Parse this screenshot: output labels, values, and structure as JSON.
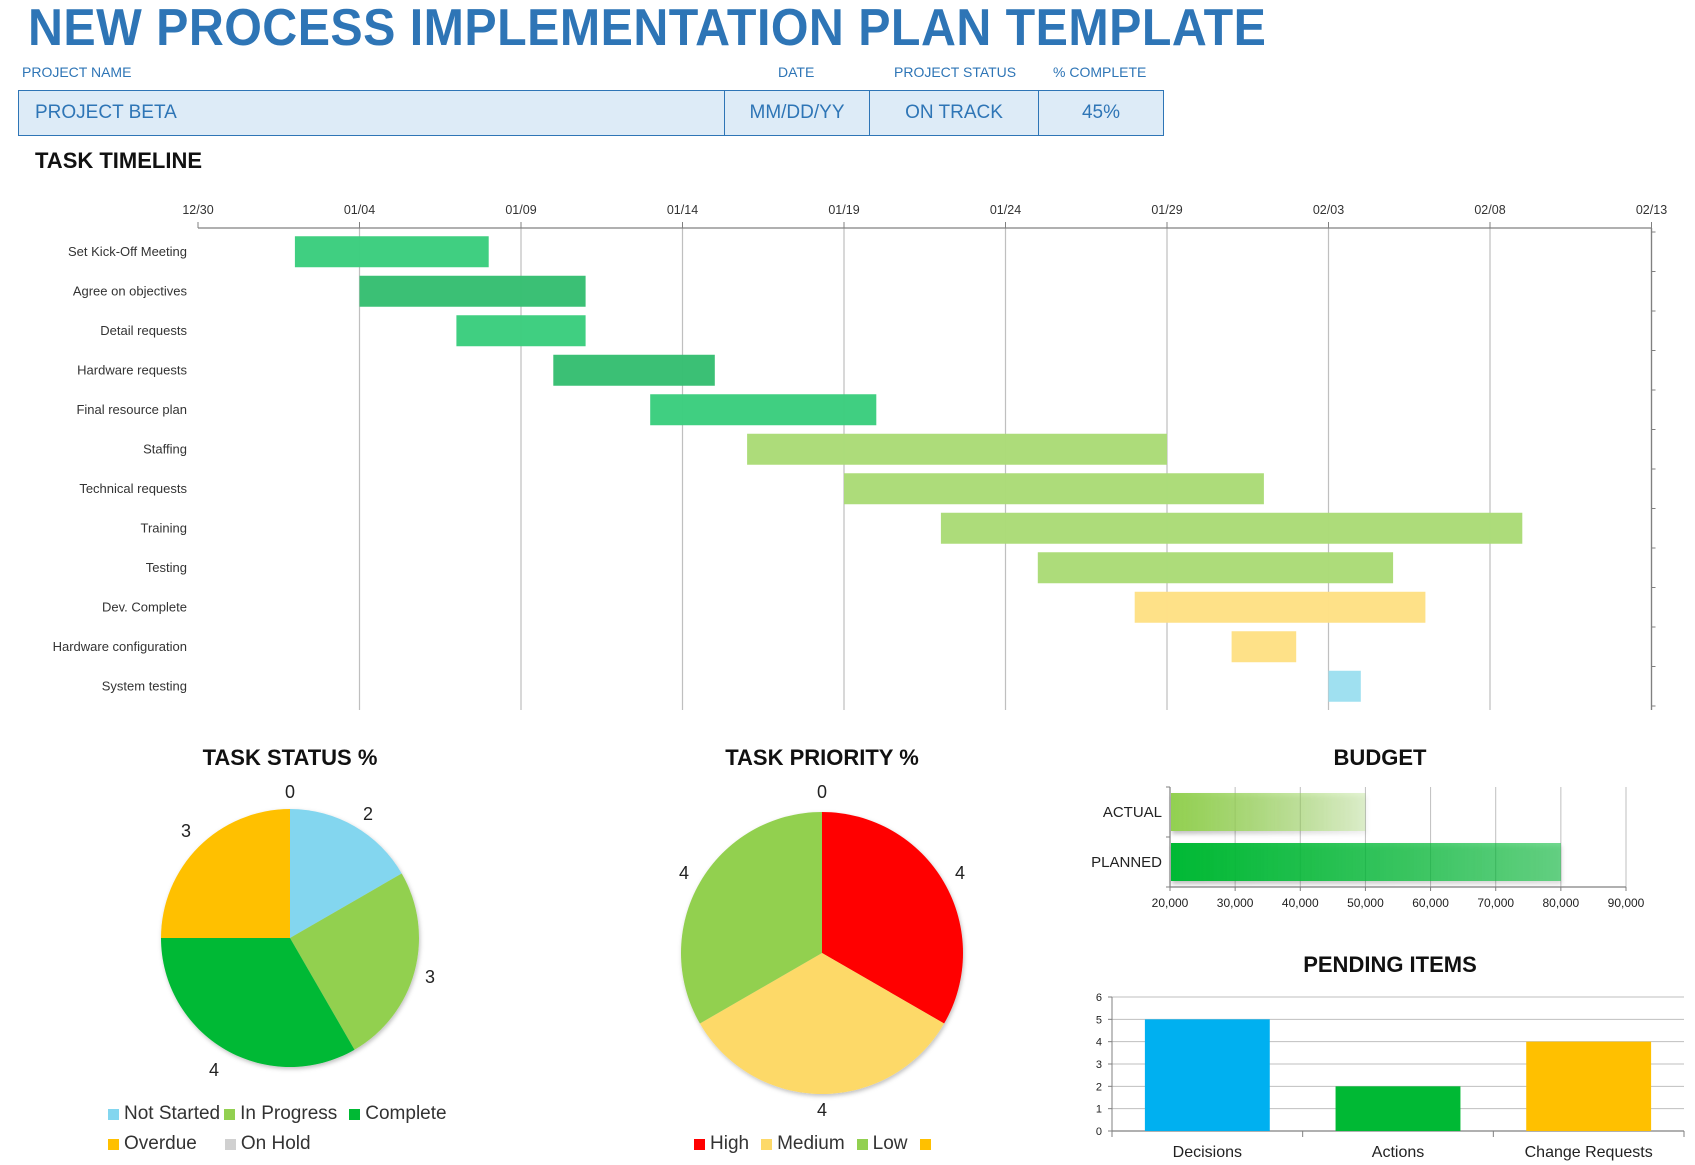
{
  "header": {
    "title": "NEW PROCESS IMPLEMENTATION PLAN TEMPLATE",
    "labels": {
      "project_name": "PROJECT NAME",
      "date": "DATE",
      "project_status": "PROJECT STATUS",
      "percent_complete": "% COMPLETE"
    },
    "values": {
      "project_name": "PROJECT BETA",
      "date": "MM/DD/YY",
      "project_status": "ON TRACK",
      "percent_complete": "45%"
    }
  },
  "colors": {
    "brand_blue": "#2E75B6",
    "info_fill": "#DDEBF7"
  },
  "chart_data": [
    {
      "id": "task-timeline",
      "type": "bar",
      "orientation": "horizontal-gantt",
      "title": "TASK TIMELINE",
      "x_tick_labels": [
        "12/30",
        "01/04",
        "01/09",
        "01/14",
        "01/19",
        "01/24",
        "01/29",
        "02/03",
        "02/08",
        "02/13"
      ],
      "x_range_days": [
        0,
        45
      ],
      "x_origin_label": "12/30",
      "grid": true,
      "tasks": [
        {
          "name": "Set Kick-Off Meeting",
          "start_day": 3,
          "duration_days": 6,
          "start": "01/02",
          "end": "01/08",
          "color": "#3CCE7E"
        },
        {
          "name": "Agree on objectives",
          "start_day": 5,
          "duration_days": 7,
          "start": "01/04",
          "end": "01/11",
          "color": "#37BF72"
        },
        {
          "name": "Detail requests",
          "start_day": 8,
          "duration_days": 4,
          "start": "01/07",
          "end": "01/11",
          "color": "#3CCE7E"
        },
        {
          "name": "Hardware requests",
          "start_day": 11,
          "duration_days": 5,
          "start": "01/10",
          "end": "01/15",
          "color": "#37BF72"
        },
        {
          "name": "Final resource plan",
          "start_day": 14,
          "duration_days": 7,
          "start": "01/13",
          "end": "01/20",
          "color": "#3CCE7E"
        },
        {
          "name": "Staffing",
          "start_day": 17,
          "duration_days": 13,
          "start": "01/16",
          "end": "01/29",
          "color": "#ABDB77"
        },
        {
          "name": "Technical requests",
          "start_day": 20,
          "duration_days": 13,
          "start": "01/19",
          "end": "02/01",
          "color": "#ABDB77"
        },
        {
          "name": "Training",
          "start_day": 23,
          "duration_days": 18,
          "start": "01/22",
          "end": "02/09",
          "color": "#ABDB77"
        },
        {
          "name": "Testing",
          "start_day": 26,
          "duration_days": 11,
          "start": "01/25",
          "end": "02/05",
          "color": "#ABDB77"
        },
        {
          "name": "Dev. Complete",
          "start_day": 29,
          "duration_days": 9,
          "start": "01/28",
          "end": "02/06",
          "color": "#FEE086"
        },
        {
          "name": "Hardware configuration",
          "start_day": 32,
          "duration_days": 2,
          "start": "01/31",
          "end": "02/02",
          "color": "#FEE086"
        },
        {
          "name": "System testing",
          "start_day": 35,
          "duration_days": 1,
          "start": "02/03",
          "end": "02/04",
          "color": "#9DDFF0"
        }
      ]
    },
    {
      "id": "task-status",
      "type": "pie",
      "title": "TASK STATUS %",
      "legend_position": "bottom",
      "slices": [
        {
          "label": "Not Started",
          "value": 2,
          "color": "#83D6EF"
        },
        {
          "label": "In Progress",
          "value": 3,
          "color": "#92D050"
        },
        {
          "label": "Complete",
          "value": 4,
          "color": "#00B934"
        },
        {
          "label": "Overdue",
          "value": 3,
          "color": "#FFC000"
        },
        {
          "label": "On Hold",
          "value": 0,
          "color": "#D0D0D0"
        }
      ]
    },
    {
      "id": "task-priority",
      "type": "pie",
      "title": "TASK PRIORITY %",
      "legend_position": "bottom",
      "slices": [
        {
          "label": "High",
          "value": 4,
          "color": "#FF0000"
        },
        {
          "label": "Medium",
          "value": 4,
          "color": "#FDD968"
        },
        {
          "label": "Low",
          "value": 4,
          "color": "#92D050"
        },
        {
          "label": "",
          "value": 0,
          "color": "#FFC000"
        }
      ]
    },
    {
      "id": "budget",
      "type": "bar",
      "orientation": "horizontal",
      "title": "BUDGET",
      "categories": [
        "ACTUAL",
        "PLANNED"
      ],
      "values": [
        50000,
        80000
      ],
      "colors": [
        "#92D050",
        "#00B934"
      ],
      "xlim": [
        20000,
        90000
      ],
      "x_ticks": [
        20000,
        30000,
        40000,
        50000,
        60000,
        70000,
        80000,
        90000
      ],
      "x_tick_labels": [
        "20,000",
        "30,000",
        "40,000",
        "50,000",
        "60,000",
        "70,000",
        "80,000",
        "90,000"
      ],
      "grid": true
    },
    {
      "id": "pending-items",
      "type": "bar",
      "title": "PENDING ITEMS",
      "categories": [
        "Decisions",
        "Actions",
        "Change Requests"
      ],
      "values": [
        5,
        2,
        4
      ],
      "colors": [
        "#00B0F0",
        "#00B934",
        "#FFC000"
      ],
      "ylim": [
        0,
        6
      ],
      "y_ticks": [
        "0",
        "1",
        "2",
        "3",
        "4",
        "5",
        "6"
      ],
      "grid": true
    }
  ]
}
